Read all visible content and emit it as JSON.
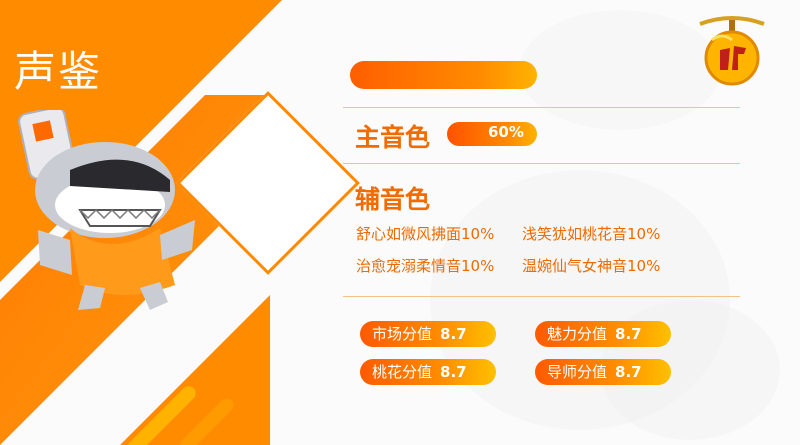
{
  "page": {
    "title": "声鉴"
  },
  "voice": {
    "main": {
      "label": "主音色",
      "percent_text": "60%",
      "percent": 60
    },
    "secondary": {
      "label": "辅音色",
      "items": [
        "舒心如微风拂面10%",
        "浅笑犹如桃花音10%",
        "治愈宠溺柔情音10%",
        "温婉仙气女神音10%"
      ]
    }
  },
  "scores": [
    {
      "label": "市场分值",
      "value": "8.7"
    },
    {
      "label": "魅力分值",
      "value": "8.7"
    },
    {
      "label": "桃花分值",
      "value": "8.7"
    },
    {
      "label": "导师分值",
      "value": "8.7"
    }
  ],
  "icons": {
    "mascot": "shark-mascot-icon",
    "logo": "propeller-ball-logo-icon"
  },
  "colors": {
    "accent": "#ff8a00",
    "accent_dark": "#f26b00",
    "line": "#f5c08a"
  }
}
